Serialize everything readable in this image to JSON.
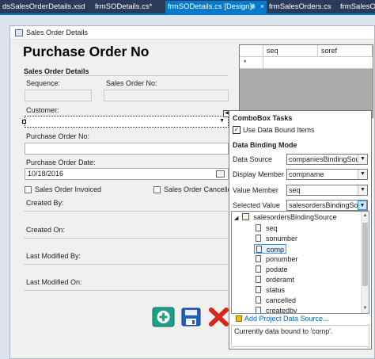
{
  "tabs": [
    {
      "label": "dsSalesOrderDetails.xsd",
      "active": false
    },
    {
      "label": "frmSODetails.cs*",
      "active": false
    },
    {
      "label": "frmSODetails.cs [Design]*",
      "active": true
    },
    {
      "label": "frmSalesOrders.cs",
      "active": false
    },
    {
      "label": "frmSalesO",
      "active": false
    }
  ],
  "tab_pin_glyph": "⊕",
  "tab_close_glyph": "×",
  "form": {
    "window_title": "Sales Order Details",
    "heading": "Purchase Order No",
    "group_title": "Sales Order Details",
    "sequence_label": "Sequence:",
    "sales_order_no_label": "Sales Order No:",
    "customer_label": "Customer:",
    "purchase_order_no_label": "Purchase Order No:",
    "purchase_order_date_label": "Purchase Order Date:",
    "purchase_order_date_value": "10/18/2016",
    "sales_order_invoiced_label": "Sales Order Invoiced",
    "sales_order_cancelled_label": "Sales Order Cancelled",
    "created_by_label": "Created By:",
    "created_on_label": "Created On:",
    "last_modified_by_label": "Last Modified By:",
    "last_modified_on_label": "Last Modified On:"
  },
  "grid": {
    "columns": [
      "seq",
      "soref"
    ],
    "new_row_marker": "*"
  },
  "tasks": {
    "title": "ComboBox Tasks",
    "use_data_bound_label": "Use Data Bound Items",
    "use_data_bound_checked": true,
    "section_title": "Data Binding Mode",
    "data_source_label": "Data Source",
    "data_source_value": "companiesBindingSou",
    "display_member_label": "Display Member",
    "display_member_value": "compname",
    "value_member_label": "Value Member",
    "value_member_value": "seq",
    "selected_value_label": "Selected Value",
    "selected_value_value": "salesordersBindingSourc",
    "tree_root": "salesordersBindingSource",
    "tree_items": [
      "seq",
      "sonumber",
      "comp",
      "ponumber",
      "podate",
      "orderamt",
      "status",
      "cancelled",
      "createdby"
    ],
    "selected_item": "comp",
    "add_link": "Add Project Data Source...",
    "status_text": "Currently data bound to 'comp'."
  },
  "colors": {
    "tab_active": "#007acc",
    "tabbar": "#2b3a58",
    "add_button": "#1aa08a",
    "save_button": "#1f5fbf",
    "cancel_button": "#d9261c"
  }
}
